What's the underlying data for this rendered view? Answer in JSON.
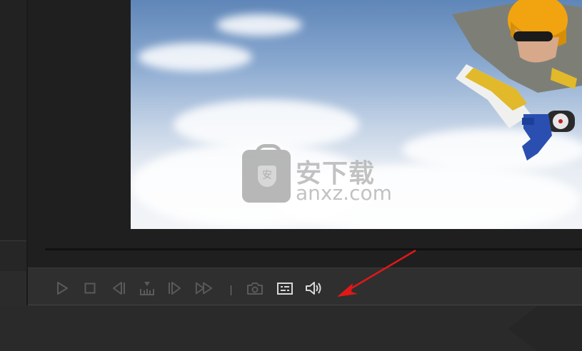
{
  "player": {
    "video": {
      "description_icon": "video-frame"
    },
    "watermark": {
      "cn_text": "安下载",
      "en_text": "anxz.com"
    }
  },
  "controls": {
    "play": {
      "icon": "play-icon"
    },
    "stop": {
      "icon": "stop-icon"
    },
    "prev_frame": {
      "icon": "step-back-icon"
    },
    "markers": {
      "icon": "marker-ruler-icon"
    },
    "next_frame": {
      "icon": "step-forward-icon"
    },
    "fast_forward": {
      "icon": "fast-forward-icon"
    },
    "snapshot": {
      "icon": "camera-icon"
    },
    "subtitles": {
      "icon": "subtitles-icon"
    },
    "volume": {
      "icon": "speaker-icon"
    }
  },
  "colors": {
    "icon_dim": "#5a5a5a",
    "icon_active": "#d8d8d8",
    "annotation_arrow": "#e01818"
  }
}
